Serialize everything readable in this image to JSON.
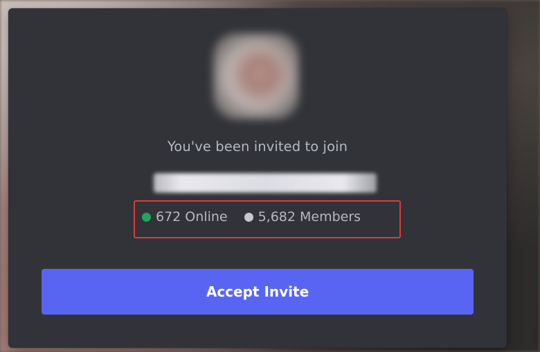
{
  "invite": {
    "subtitle": "You've been invited to join",
    "server_name": "",
    "online_count": "672 Online",
    "member_count": "5,682 Members",
    "accept_label": "Accept Invite"
  },
  "colors": {
    "modal_bg": "#313338",
    "accent": "#5865f2",
    "online_dot": "#23a55a",
    "members_dot": "#c7c8ce",
    "highlight_box": "#e03a3a",
    "muted_text": "#b5bac1"
  }
}
